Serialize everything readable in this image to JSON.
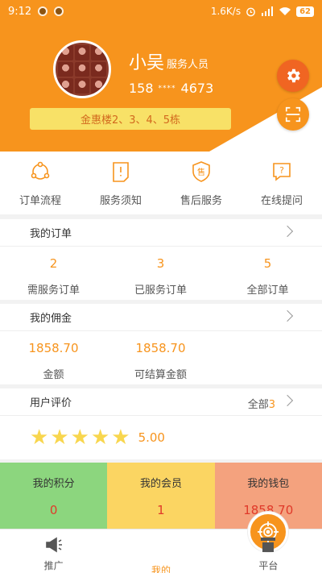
{
  "status_bar": {
    "time": "9:12",
    "network_speed": "1.6K/s",
    "battery": "62"
  },
  "profile": {
    "name": "小吴",
    "role": "服务人员",
    "phone_prefix": "158",
    "phone_mask": "****",
    "phone_suffix": "4673",
    "building": "金惠楼2、3、4、5栋"
  },
  "quick_menu": [
    {
      "label": "订单流程",
      "icon": "order-flow-icon"
    },
    {
      "label": "服务须知",
      "icon": "service-notice-icon"
    },
    {
      "label": "售后服务",
      "icon": "after-sales-icon"
    },
    {
      "label": "在线提问",
      "icon": "online-question-icon"
    }
  ],
  "orders": {
    "title": "我的订单",
    "stats": [
      {
        "value": "2",
        "label": "需服务订单"
      },
      {
        "value": "3",
        "label": "已服务订单"
      },
      {
        "value": "5",
        "label": "全部订单"
      }
    ]
  },
  "commission": {
    "title": "我的佣金",
    "stats": [
      {
        "value": "1858.70",
        "label": "金额"
      },
      {
        "value": "1858.70",
        "label": "可结算金额"
      }
    ]
  },
  "reviews": {
    "title": "用户评价",
    "all_label": "全部",
    "count": "3",
    "stars": 5,
    "score": "5.00"
  },
  "tiles": [
    {
      "title": "我的积分",
      "value": "0",
      "color": "#8cd67e"
    },
    {
      "title": "我的会员",
      "value": "1",
      "color": "#fbd562"
    },
    {
      "title": "我的钱包",
      "value": "1858.70",
      "color": "#f4a27e"
    }
  ],
  "bottom_nav": [
    {
      "label": "推广",
      "icon": "megaphone-icon"
    },
    {
      "label": "我的",
      "icon": "target-icon"
    },
    {
      "label": "平台",
      "icon": "platform-icon"
    }
  ],
  "colors": {
    "accent": "#f7941d",
    "settings": "#f06522",
    "badge": "#f8e167"
  }
}
